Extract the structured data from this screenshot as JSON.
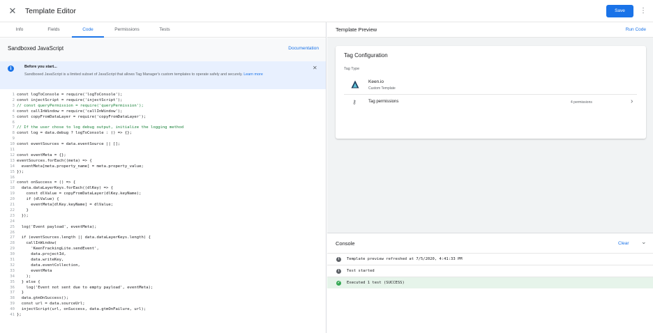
{
  "header": {
    "title": "Template Editor",
    "save_label": "Save"
  },
  "tabs": [
    {
      "label": "Info"
    },
    {
      "label": "Fields"
    },
    {
      "label": "Code"
    },
    {
      "label": "Permissions"
    },
    {
      "label": "Tests"
    }
  ],
  "code_section": {
    "title": "Sandboxed JavaScript",
    "doc_link": "Documentation"
  },
  "notice": {
    "title": "Before you start...",
    "body": "Sandboxed JavaScript is a limited subset of JavaScript that allows Tag Manager's custom templates to operate safely and securely. ",
    "link": "Learn more"
  },
  "code_lines": [
    {
      "n": "1",
      "t": "const logToConsole = require('logToConsole');"
    },
    {
      "n": "2",
      "t": "const injectScript = require('injectScript');"
    },
    {
      "n": "3",
      "t": "// const queryPermission = require('queryPermission');",
      "c": true
    },
    {
      "n": "4",
      "t": "const callInWindow = require('callInWindow');"
    },
    {
      "n": "5",
      "t": "const copyFromDataLayer = require('copyFromDataLayer');"
    },
    {
      "n": "6",
      "t": ""
    },
    {
      "n": "7",
      "t": "// If the user chose to log debug output, initialize the logging method",
      "c": true
    },
    {
      "n": "8",
      "t": "const log = data.debug ? logToConsole : () => {};"
    },
    {
      "n": "9",
      "t": ""
    },
    {
      "n": "10",
      "t": "const eventSources = data.eventSource || [];"
    },
    {
      "n": "11",
      "t": ""
    },
    {
      "n": "12",
      "t": "const eventMeta = {};"
    },
    {
      "n": "13",
      "t": "eventSources.forEach((meta) => {"
    },
    {
      "n": "14",
      "t": "  eventMeta[meta.property_name] = meta.property_value;"
    },
    {
      "n": "15",
      "t": "});"
    },
    {
      "n": "16",
      "t": ""
    },
    {
      "n": "17",
      "t": "const onSuccess = () => {"
    },
    {
      "n": "18",
      "t": "  data.dataLayerKeys.forEach((dlKey) => {"
    },
    {
      "n": "19",
      "t": "    const dlValue = copyFromDataLayer(dlKey.keyName);"
    },
    {
      "n": "20",
      "t": "    if (dlValue) {"
    },
    {
      "n": "21",
      "t": "      eventMeta[dlKey.keyName] = dlValue;"
    },
    {
      "n": "22",
      "t": "    }"
    },
    {
      "n": "23",
      "t": "  });"
    },
    {
      "n": "24",
      "t": ""
    },
    {
      "n": "25",
      "t": "  log('Event payload', eventMeta);"
    },
    {
      "n": "26",
      "t": ""
    },
    {
      "n": "27",
      "t": "  if (eventSources.length || data.dataLayerKeys.length) {"
    },
    {
      "n": "28",
      "t": "    callInWindow("
    },
    {
      "n": "29",
      "t": "      'KeenTrackingLite.sendEvent',"
    },
    {
      "n": "30",
      "t": "      data.projectId,"
    },
    {
      "n": "31",
      "t": "      data.writeKey,"
    },
    {
      "n": "32",
      "t": "      data.eventCollection,"
    },
    {
      "n": "33",
      "t": "      eventMeta"
    },
    {
      "n": "34",
      "t": "    );"
    },
    {
      "n": "35",
      "t": "  } else {"
    },
    {
      "n": "36",
      "t": "    log('Event not sent due to empty payload', eventMeta);"
    },
    {
      "n": "37",
      "t": "  }"
    },
    {
      "n": "38",
      "t": "  data.gtmOnSuccess();"
    },
    {
      "n": "39",
      "t": "  const url = data.sourceUrl;"
    },
    {
      "n": "40",
      "t": "  injectScript(url, onSuccess, data.gtmOnFailure, url);"
    },
    {
      "n": "41",
      "t": "};"
    }
  ],
  "preview": {
    "title": "Template Preview",
    "run_label": "Run Code"
  },
  "tag_config": {
    "title": "Tag Configuration",
    "type_label": "Tag Type",
    "tag_name": "Keen.io",
    "tag_sub": "Custom Template",
    "perm_label": "Tag permissions",
    "perm_count": "4 permissions"
  },
  "console": {
    "title": "Console",
    "clear_label": "Clear",
    "logs": [
      {
        "text": "Template preview refreshed at 7/5/2020, 4:41:33 PM",
        "kind": "info"
      },
      {
        "text": "Test started",
        "kind": "info"
      },
      {
        "text": "Executed 1 test (SUCCESS)",
        "kind": "success"
      }
    ]
  },
  "colors": {
    "accent": "#1a73e8",
    "success_bg": "#e6f4ea",
    "success": "#34a853",
    "notice_bg": "#e8f0fe"
  },
  "icons": {
    "close": "close-icon",
    "more": "more-vert-icon",
    "info": "info-icon",
    "keen": "keen-logo-icon",
    "key": "key-icon",
    "chevron": "chevron-right-icon",
    "collapse": "chevron-down-icon",
    "check": "check-circle-icon"
  }
}
